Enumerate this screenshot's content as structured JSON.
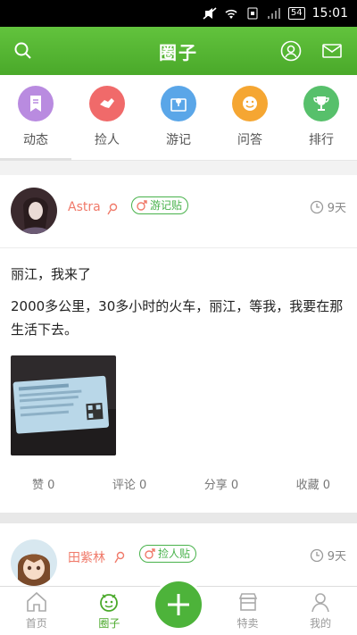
{
  "status": {
    "battery": "54",
    "time": "15:01"
  },
  "header": {
    "title": "圈子"
  },
  "tabs": [
    {
      "label": "动态",
      "color": "#b98be0"
    },
    {
      "label": "捡人",
      "color": "#f06a6a"
    },
    {
      "label": "游记",
      "color": "#5aa6e8"
    },
    {
      "label": "问答",
      "color": "#f5a632"
    },
    {
      "label": "排行",
      "color": "#57c06b"
    }
  ],
  "posts": [
    {
      "user": "Astra",
      "tag": "游记贴",
      "time": "9天",
      "title": "丽江，我来了",
      "body": "2000多公里，30多小时的火车，丽江，等我，我要在那生活下去。",
      "likes": "赞 0",
      "comments": "评论 0",
      "shares": "分享 0",
      "favorites": "收藏 0"
    },
    {
      "user": "田紫林",
      "tag": "捡人贴",
      "time": "9天"
    }
  ],
  "bottom_nav": [
    {
      "label": "首页"
    },
    {
      "label": "圈子"
    },
    {
      "label": "特卖"
    },
    {
      "label": "我的"
    }
  ],
  "colors": {
    "brand_green": "#4aa92a",
    "username": "#f07a6a"
  }
}
